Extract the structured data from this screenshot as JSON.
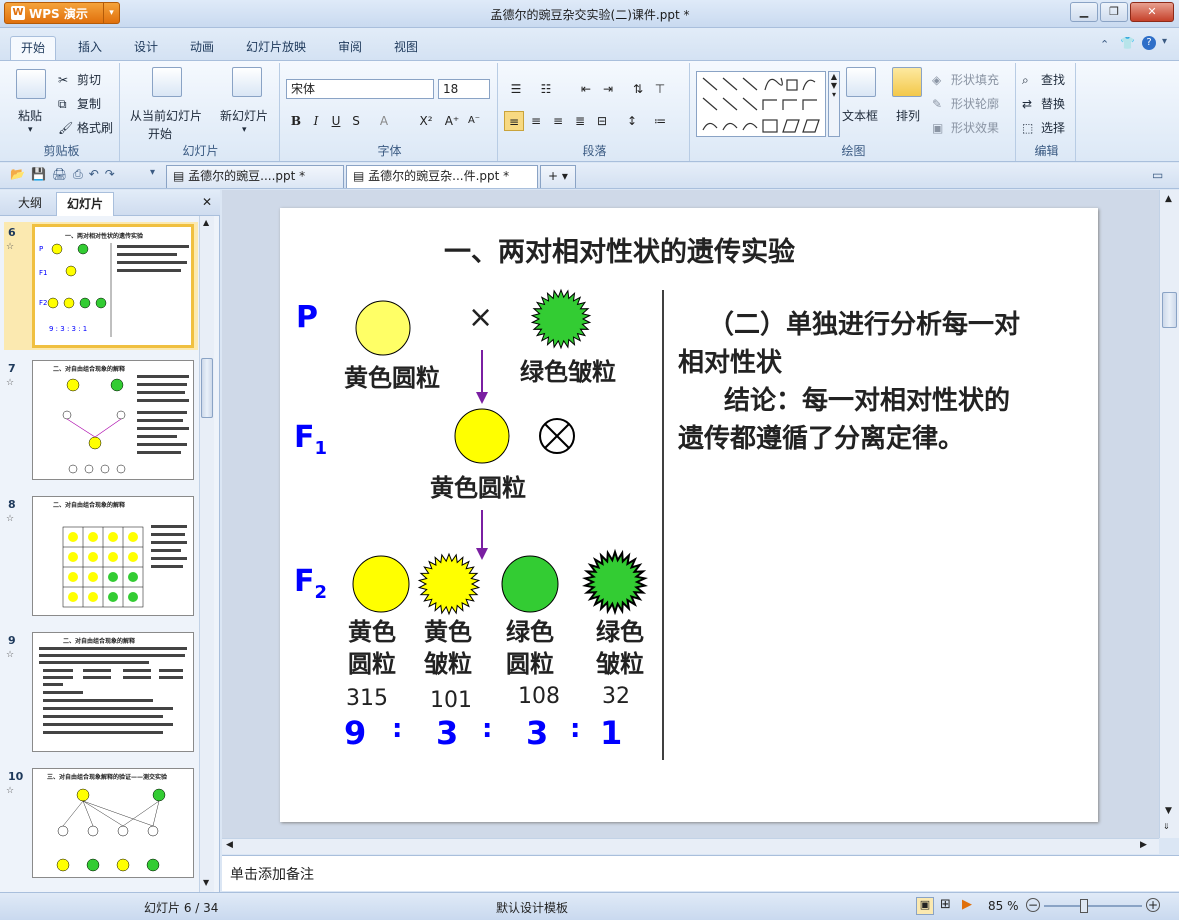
{
  "window": {
    "app_name": "WPS 演示",
    "title": "孟德尔的豌豆杂交实验(二)课件.ppt *"
  },
  "ribbon_tabs": [
    "开始",
    "插入",
    "设计",
    "动画",
    "幻灯片放映",
    "审阅",
    "视图"
  ],
  "clipboard": {
    "paste": "粘贴",
    "cut": "剪切",
    "copy": "复制",
    "format_painter": "格式刷",
    "label": "剪贴板"
  },
  "slides_group": {
    "from_current": "从当前幻灯片",
    "start": "开始",
    "new_slide": "新幻灯片",
    "label": "幻灯片"
  },
  "font_group": {
    "font_name": "宋体",
    "font_size": "18",
    "label": "字体"
  },
  "paragraph_group": {
    "label": "段落"
  },
  "drawing_group": {
    "textbox": "文本框",
    "arrange": "排列",
    "shape_fill": "形状填充",
    "shape_outline": "形状轮廓",
    "shape_effect": "形状效果",
    "label": "绘图"
  },
  "edit_group": {
    "find": "查找",
    "replace": "替换",
    "select": "选择",
    "label": "编辑"
  },
  "doc_tabs": [
    "孟德尔的豌豆....ppt *",
    "孟德尔的豌豆杂...件.ppt *"
  ],
  "left_panel": {
    "tabs": [
      "大纲",
      "幻灯片"
    ]
  },
  "thumbs": [
    {
      "num": "6",
      "title": "一、两对相对性状的遗传实验"
    },
    {
      "num": "7",
      "title": "二、对自由组合现象的解释"
    },
    {
      "num": "8",
      "title": "二、对自由组合现象的解释"
    },
    {
      "num": "9",
      "title": "二、对自由组合现象的解释"
    },
    {
      "num": "10",
      "title": "三、对自由组合现象解释的验证——测交实验"
    }
  ],
  "slide": {
    "title": "一、两对相对性状的遗传实验",
    "p_label": "P",
    "cross": "×",
    "p1_label": "黄色圆粒",
    "p2_label": "绿色皱粒",
    "f1_label": "F",
    "f1_sub": "1",
    "f1_pheno": "黄色圆粒",
    "f2_label": "F",
    "f2_sub": "2",
    "f2_phenotypes": [
      {
        "line1": "黄色",
        "line2": "圆粒",
        "count": "315",
        "ratio": "9"
      },
      {
        "line1": "黄色",
        "line2": "皱粒",
        "count": "101",
        "ratio": "3"
      },
      {
        "line1": "绿色",
        "line2": "圆粒",
        "count": "108",
        "ratio": "3"
      },
      {
        "line1": "绿色",
        "line2": "皱粒",
        "count": "32",
        "ratio": "1"
      }
    ],
    "ratio_sep": ":",
    "right_text_1": "（二）单独进行分析每一对",
    "right_text_2": "相对性状",
    "right_text_3": "结论：每一对相对性状的",
    "right_text_4": "遗传都遵循了分离定律。",
    "colors": {
      "yellow": "#ffff00",
      "green": "#33cc33",
      "blue": "#0000ff",
      "arrow": "#7a1fa2"
    }
  },
  "notes": "单击添加备注",
  "status": {
    "slide_count": "幻灯片 6 / 34",
    "template": "默认设计模板",
    "zoom": "85 %"
  }
}
